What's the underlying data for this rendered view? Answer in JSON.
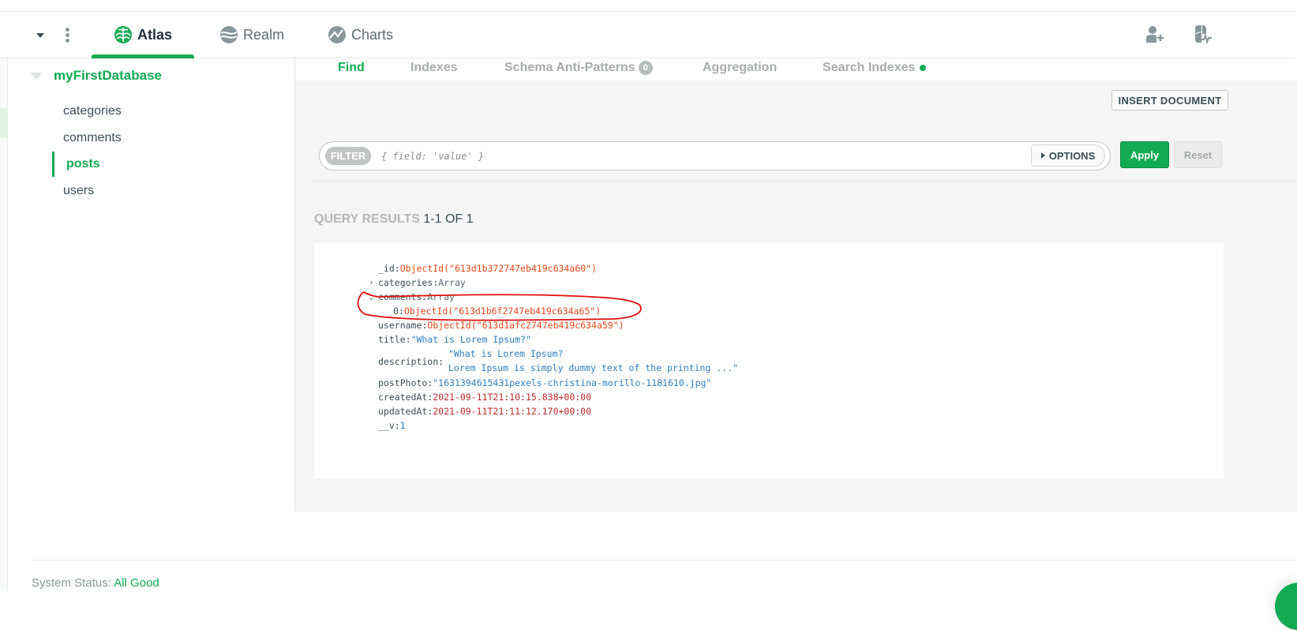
{
  "topnav": {
    "tabs": [
      {
        "label": "Atlas",
        "icon": "atlas-leaf-icon",
        "active": true
      },
      {
        "label": "Realm",
        "icon": "realm-wave-icon",
        "active": false
      },
      {
        "label": "Charts",
        "icon": "charts-line-icon",
        "active": false
      }
    ],
    "right_icons": [
      "invite-user-icon",
      "activity-feed-icon"
    ]
  },
  "sidebar": {
    "database": "myFirstDatabase",
    "collections": [
      {
        "name": "categories",
        "active": false
      },
      {
        "name": "comments",
        "active": false
      },
      {
        "name": "posts",
        "active": true
      },
      {
        "name": "users",
        "active": false
      }
    ]
  },
  "collection_tabs": [
    {
      "label": "Find",
      "active": true
    },
    {
      "label": "Indexes",
      "active": false
    },
    {
      "label": "Schema Anti-Patterns",
      "badge": "0",
      "active": false
    },
    {
      "label": "Aggregation",
      "active": false
    },
    {
      "label": "Search Indexes",
      "status_dot": true,
      "active": false
    }
  ],
  "toolbar": {
    "insert_document": "INSERT DOCUMENT",
    "filter_label": "FILTER",
    "filter_placeholder": "{ field: 'value' }",
    "filter_value": "",
    "options_label": "OPTIONS",
    "apply_label": "Apply",
    "reset_label": "Reset"
  },
  "results": {
    "label": "QUERY RESULTS",
    "count": "1-1 OF 1"
  },
  "document": {
    "fields": [
      {
        "key": "_id",
        "value": "ObjectId(\"613d1b372747eb419c634a60\")",
        "type": "oid"
      },
      {
        "key": "categories",
        "value": "Array",
        "type": "array",
        "expanded": false
      },
      {
        "key": "comments",
        "value": "Array",
        "type": "array",
        "expanded": true
      },
      {
        "key": "0",
        "value": "ObjectId(\"613d1b6f2747eb419c634a65\")",
        "type": "oid",
        "nested": true
      },
      {
        "key": "username",
        "value": "ObjectId(\"613d1afc2747eb419c634a59\")",
        "type": "oid"
      },
      {
        "key": "title",
        "value": "\"What is Lorem Ipsum?\"",
        "type": "string"
      },
      {
        "key": "description",
        "value_line1": "\"What is Lorem Ipsum?",
        "value_line2": "Lorem Ipsum is simply dummy text of the printing ...\"",
        "type": "string"
      },
      {
        "key": "postPhoto",
        "value": "\"1631394615431pexels-christina-morillo-1181610.jpg\"",
        "type": "string"
      },
      {
        "key": "createdAt",
        "value": "2021-09-11T21:10:15.838+00:00",
        "type": "date"
      },
      {
        "key": "updatedAt",
        "value": "2021-09-11T21:11:12.170+00:00",
        "type": "date"
      },
      {
        "key": "__v",
        "value": "1",
        "type": "number"
      }
    ],
    "sep": ":"
  },
  "footer": {
    "status_label": "System Status:",
    "status_value": "All Good"
  },
  "colors": {
    "brand_green": "#13aa52",
    "oid_orange": "#e8481c",
    "string_blue": "#2f7fc0",
    "date_red": "#c0292b",
    "annotation_red": "#e01010"
  }
}
